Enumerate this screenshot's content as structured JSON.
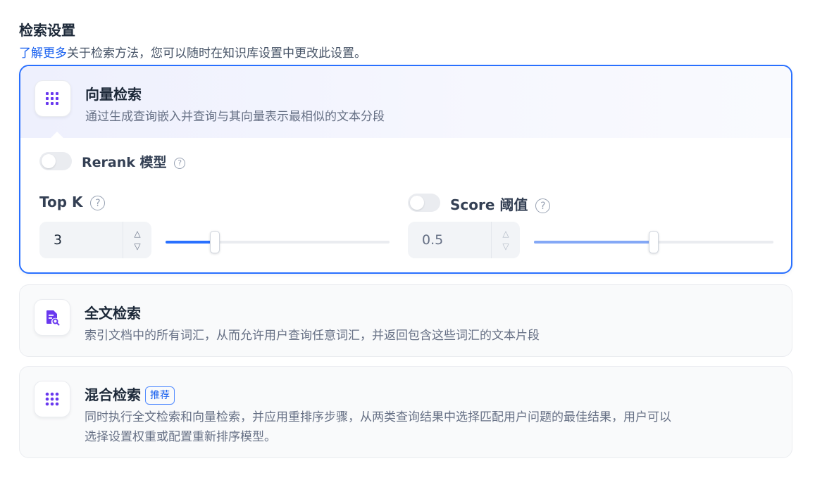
{
  "retrieval": {
    "title": "检索设置",
    "learn_more": "了解更多",
    "description": "关于检索方法，您可以随时在知识库设置中更改此设置。"
  },
  "vector": {
    "title": "向量检索",
    "description": "通过生成查询嵌入并查询与其向量表示最相似的文本分段",
    "rerank_label": "Rerank 模型",
    "rerank_enabled": false,
    "top_k_label": "Top K",
    "top_k_value": "3",
    "top_k_fraction": 0.22,
    "score_label": "Score 阈值",
    "score_enabled": false,
    "score_value": "0.5",
    "score_fraction": 0.5
  },
  "fulltext": {
    "title": "全文检索",
    "description": "索引文档中的所有词汇，从而允许用户查询任意词汇，并返回包含这些词汇的文本片段"
  },
  "hybrid": {
    "title": "混合检索",
    "badge": "推荐",
    "description_line1": "同时执行全文检索和向量检索，并应用重排序步骤，从两类查询结果中选择匹配用户问题的最佳结果，用户可以",
    "description_line2": "选择设置权重或配置重新排序模型。"
  },
  "colors": {
    "primary": "#2970ff",
    "icon_purple": "#6938ef",
    "link": "#155eef"
  }
}
